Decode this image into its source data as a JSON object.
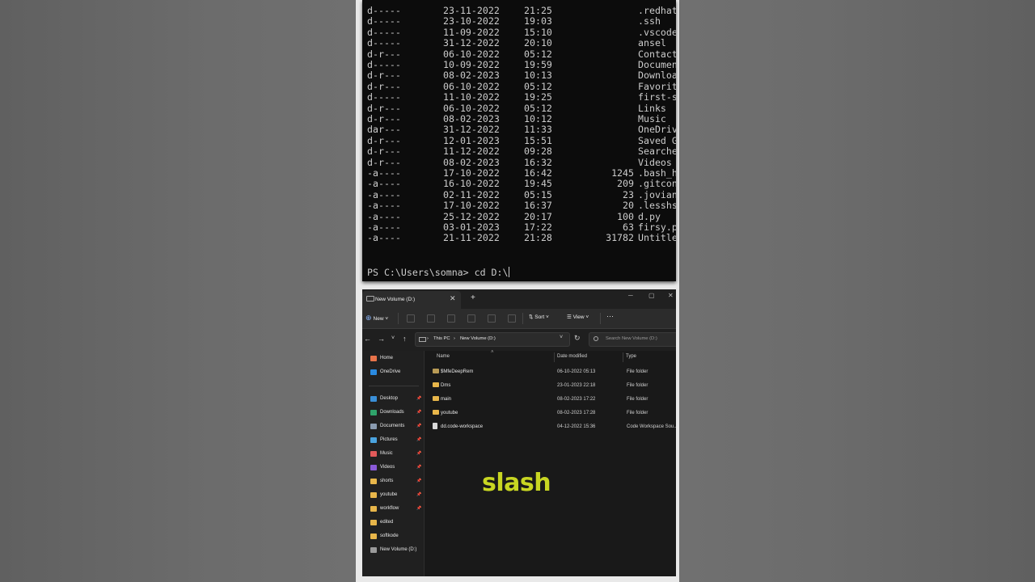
{
  "terminal": {
    "rows": [
      {
        "mode": "d-----",
        "date": "23-11-2022",
        "time": "21:25",
        "length": "",
        "name": ".redhat"
      },
      {
        "mode": "d-----",
        "date": "23-10-2022",
        "time": "19:03",
        "length": "",
        "name": ".ssh"
      },
      {
        "mode": "d-----",
        "date": "11-09-2022",
        "time": "15:10",
        "length": "",
        "name": ".vscode"
      },
      {
        "mode": "d-----",
        "date": "31-12-2022",
        "time": "20:10",
        "length": "",
        "name": "ansel"
      },
      {
        "mode": "d-r---",
        "date": "06-10-2022",
        "time": "05:12",
        "length": "",
        "name": "Contact"
      },
      {
        "mode": "d-----",
        "date": "10-09-2022",
        "time": "19:59",
        "length": "",
        "name": "Documen"
      },
      {
        "mode": "d-r---",
        "date": "08-02-2023",
        "time": "10:13",
        "length": "",
        "name": "Downloa"
      },
      {
        "mode": "d-r---",
        "date": "06-10-2022",
        "time": "05:12",
        "length": "",
        "name": "Favorit"
      },
      {
        "mode": "d-----",
        "date": "11-10-2022",
        "time": "19:25",
        "length": "",
        "name": "first-s"
      },
      {
        "mode": "d-r---",
        "date": "06-10-2022",
        "time": "05:12",
        "length": "",
        "name": "Links"
      },
      {
        "mode": "d-r---",
        "date": "08-02-2023",
        "time": "10:12",
        "length": "",
        "name": "Music"
      },
      {
        "mode": "dar---",
        "date": "31-12-2022",
        "time": "11:33",
        "length": "",
        "name": "OneDriv"
      },
      {
        "mode": "d-r---",
        "date": "12-01-2023",
        "time": "15:51",
        "length": "",
        "name": "Saved G"
      },
      {
        "mode": "d-r---",
        "date": "11-12-2022",
        "time": "09:28",
        "length": "",
        "name": "Searche"
      },
      {
        "mode": "d-r---",
        "date": "08-02-2023",
        "time": "16:32",
        "length": "",
        "name": "Videos"
      },
      {
        "mode": "-a----",
        "date": "17-10-2022",
        "time": "16:42",
        "length": "1245",
        "name": ".bash_h"
      },
      {
        "mode": "-a----",
        "date": "16-10-2022",
        "time": "19:45",
        "length": "209",
        "name": ".gitcon"
      },
      {
        "mode": "-a----",
        "date": "02-11-2022",
        "time": "05:15",
        "length": "23",
        "name": ".jovian"
      },
      {
        "mode": "-a----",
        "date": "17-10-2022",
        "time": "16:37",
        "length": "20",
        "name": ".lesshs"
      },
      {
        "mode": "-a----",
        "date": "25-12-2022",
        "time": "20:17",
        "length": "100",
        "name": "d.py"
      },
      {
        "mode": "-a----",
        "date": "03-01-2023",
        "time": "17:22",
        "length": "63",
        "name": "firsy.p"
      },
      {
        "mode": "-a----",
        "date": "21-11-2022",
        "time": "21:28",
        "length": "31782",
        "name": "Untitle"
      }
    ],
    "prompt": "PS C:\\Users\\somna> cd D:\\"
  },
  "explorer": {
    "tab_title": "New Volume (D:)",
    "tab_close": "✕",
    "tab_add": "+",
    "toolbar": {
      "new_label": "New",
      "sort_label": "Sort",
      "view_label": "View",
      "more_label": "···"
    },
    "address": {
      "crumbs": [
        "This PC",
        "New Volume (D:)"
      ],
      "separator": "›"
    },
    "search_placeholder": "Search New Volume (D:)",
    "nav_items": [
      {
        "label": "Home",
        "icon": "home-icon",
        "color": "#e8734a",
        "pinned": false
      },
      {
        "label": "OneDrive",
        "icon": "cloud-icon",
        "color": "#2a8ae0",
        "pinned": false
      },
      {
        "label": "Desktop",
        "icon": "desktop-icon",
        "color": "#3a8fd8",
        "pinned": true
      },
      {
        "label": "Downloads",
        "icon": "download-icon",
        "color": "#2fa36b",
        "pinned": true
      },
      {
        "label": "Documents",
        "icon": "document-icon",
        "color": "#8a9bb0",
        "pinned": true
      },
      {
        "label": "Pictures",
        "icon": "picture-icon",
        "color": "#4aa3df",
        "pinned": true
      },
      {
        "label": "Music",
        "icon": "music-icon",
        "color": "#e25a5a",
        "pinned": true
      },
      {
        "label": "Videos",
        "icon": "video-icon",
        "color": "#8a5ad8",
        "pinned": true
      },
      {
        "label": "shorts",
        "icon": "folder-icon",
        "color": "#e8b64a",
        "pinned": true
      },
      {
        "label": "youtube",
        "icon": "folder-icon",
        "color": "#e8b64a",
        "pinned": true
      },
      {
        "label": "workflow",
        "icon": "folder-icon",
        "color": "#e8b64a",
        "pinned": true
      },
      {
        "label": "edited",
        "icon": "folder-icon",
        "color": "#e8b64a",
        "pinned": false
      },
      {
        "label": "softkode",
        "icon": "folder-icon",
        "color": "#e8b64a",
        "pinned": false
      },
      {
        "label": "New Volume (D:)",
        "icon": "drive-icon",
        "color": "#9a9a9a",
        "pinned": false
      }
    ],
    "columns": {
      "name": "Name",
      "date": "Date modified",
      "type": "Type"
    },
    "files": [
      {
        "name": "$MfeDeepRem",
        "date": "06-10-2022 05:13",
        "type": "File folder",
        "icon": "folder-icon",
        "color": "#b89a55"
      },
      {
        "name": "Dms",
        "date": "23-01-2023 22:18",
        "type": "File folder",
        "icon": "folder-icon",
        "color": "#e8b64a"
      },
      {
        "name": "main",
        "date": "08-02-2023 17:22",
        "type": "File folder",
        "icon": "folder-icon",
        "color": "#e8b64a"
      },
      {
        "name": "youtube",
        "date": "08-02-2023 17:28",
        "type": "File folder",
        "icon": "folder-icon",
        "color": "#e8b64a"
      },
      {
        "name": "dd.code-workspace",
        "date": "04-12-2022 15:36",
        "type": "Code Workspace Sou...",
        "icon": "file-icon",
        "color": "#d8d8d8"
      }
    ]
  },
  "caption": "slash",
  "colors": {
    "accent": "#c8d622",
    "terminal_bg": "#0c0c0c",
    "explorer_bg": "#191919"
  }
}
